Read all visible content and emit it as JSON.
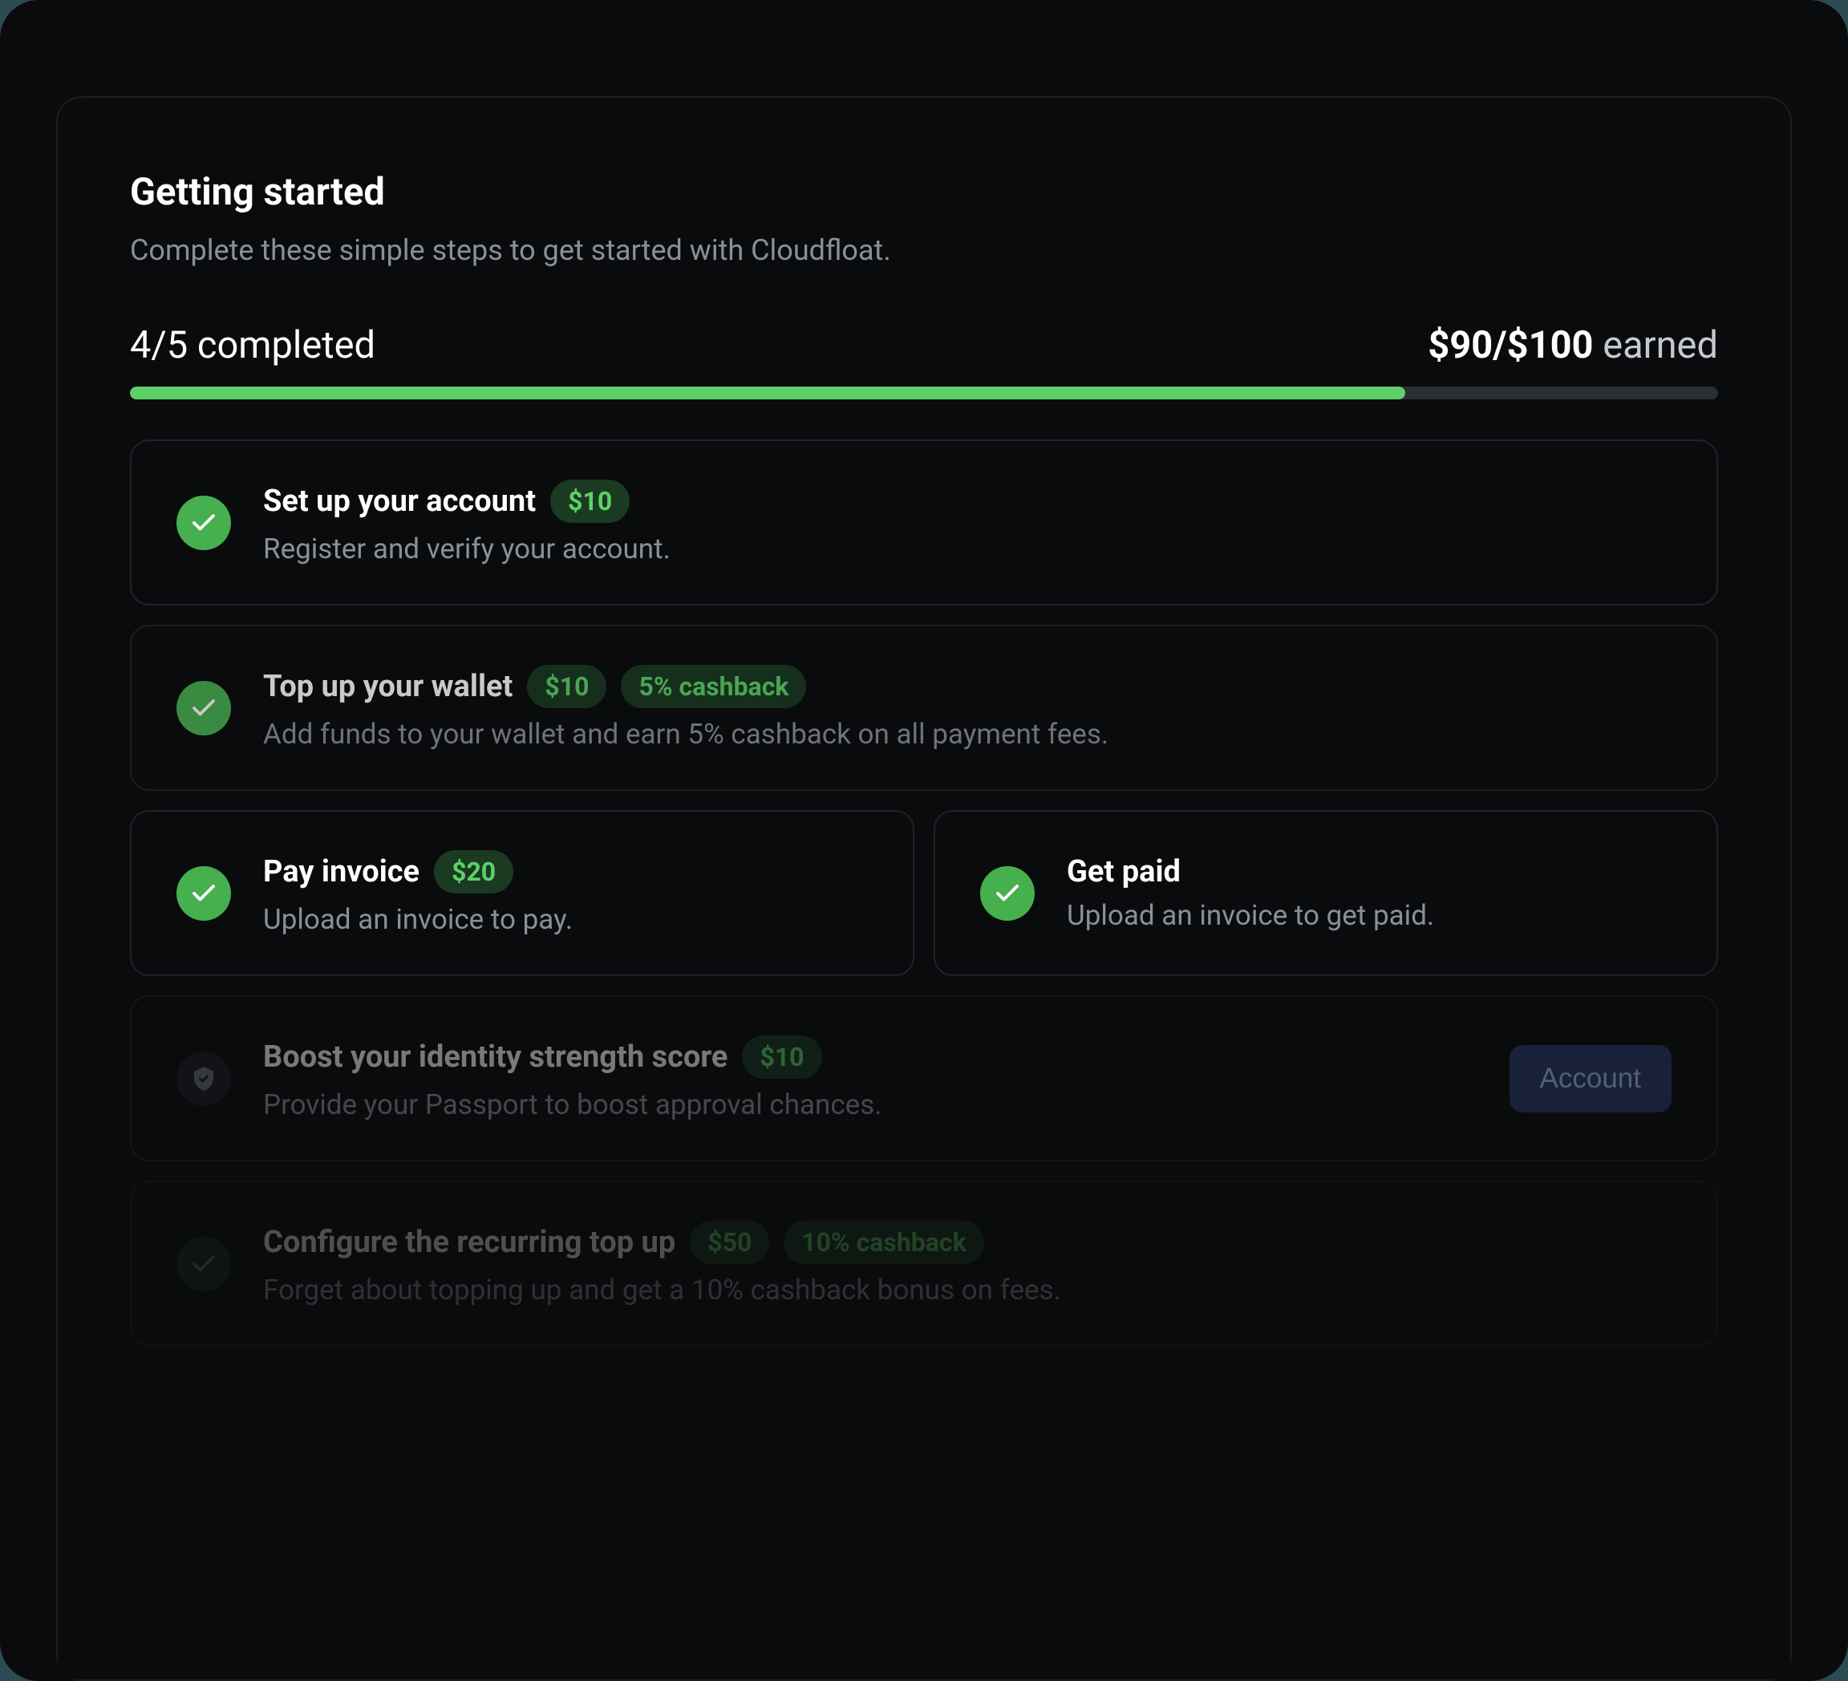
{
  "header": {
    "title": "Getting started",
    "subtitle": "Complete these simple steps to get started with Cloudfloat."
  },
  "progress": {
    "completed_text": "4/5 completed",
    "earned_bold": "$90/$100",
    "earned_label": " earned",
    "percent": 80.3
  },
  "tasks": {
    "setup_account": {
      "title": "Set up your account",
      "badge": "$10",
      "desc": "Register and verify your account."
    },
    "top_up": {
      "title": "Top up your wallet",
      "badge": "$10",
      "badge2": "5% cashback",
      "desc": "Add funds to your wallet and earn 5% cashback on all payment fees."
    },
    "pay_invoice": {
      "title": "Pay invoice",
      "badge": "$20",
      "desc": "Upload an invoice to pay."
    },
    "get_paid": {
      "title": "Get paid",
      "desc": "Upload an invoice to get paid."
    },
    "boost_identity": {
      "title": "Boost your identity strength score",
      "badge": "$10",
      "desc": "Provide your Passport to boost approval chances.",
      "action": "Account"
    },
    "recurring": {
      "title": "Configure the recurring top up",
      "badge": "$50",
      "badge2": "10% cashback",
      "desc": "Forget about topping up and get a 10% cashback bonus on fees."
    }
  }
}
